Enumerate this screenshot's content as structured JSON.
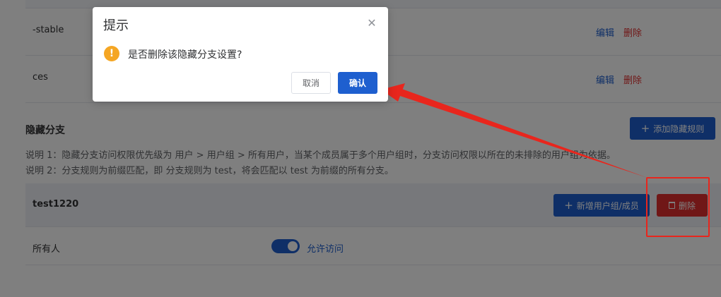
{
  "branches": [
    {
      "name": "-stable",
      "edit_label": "编辑",
      "delete_label": "删除"
    },
    {
      "name": "ces",
      "edit_label": "编辑",
      "delete_label": "删除"
    }
  ],
  "hidden_branch": {
    "title": "隐藏分支",
    "add_rule_label": "添加隐藏规则",
    "note1": "说明 1：隐藏分支访问权限优先级为 用户 > 用户组 > 所有用户，当某个成员属于多个用户组时，分支访问权限以所在的未排除的用户组为依据。",
    "note2": "说明 2：分支规则为前缀匹配，即 分支规则为 test，将会匹配以 test 为前缀的所有分支。",
    "rule": {
      "name": "test1220",
      "add_member_label": "新增用户组/成员",
      "delete_label": "删除"
    },
    "members": [
      {
        "name": "所有人",
        "toggle_on": true,
        "toggle_label": "允许访问"
      }
    ]
  },
  "dialog": {
    "title": "提示",
    "message": "是否删除该隐藏分支设置?",
    "cancel_label": "取消",
    "confirm_label": "确认",
    "close_icon": "close-icon",
    "warning_icon": "warning-icon"
  },
  "colors": {
    "primary": "#1e5fcf",
    "danger": "#e02f2f",
    "warning": "#f5a623",
    "annotation": "#e8261d"
  }
}
